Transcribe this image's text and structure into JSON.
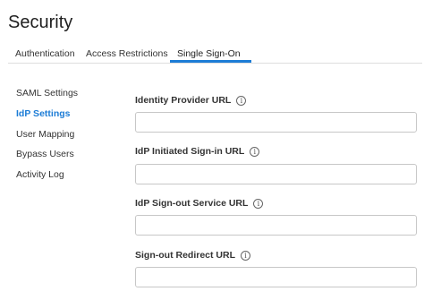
{
  "header": {
    "title": "Security"
  },
  "tabs": [
    {
      "label": "Authentication",
      "active": false
    },
    {
      "label": "Access Restrictions",
      "active": false
    },
    {
      "label": "Single Sign-On",
      "active": true
    }
  ],
  "sidebar": {
    "items": [
      {
        "label": "SAML Settings",
        "active": false
      },
      {
        "label": "IdP Settings",
        "active": true
      },
      {
        "label": "User Mapping",
        "active": false
      },
      {
        "label": "Bypass Users",
        "active": false
      },
      {
        "label": "Activity Log",
        "active": false
      }
    ]
  },
  "form": {
    "fields": [
      {
        "label": "Identity Provider URL",
        "value": "",
        "icon": "info-icon"
      },
      {
        "label": "IdP Initiated Sign-in URL",
        "value": "",
        "icon": "info-icon"
      },
      {
        "label": "IdP Sign-out Service URL",
        "value": "",
        "icon": "info-icon"
      },
      {
        "label": "Sign-out Redirect URL",
        "value": "",
        "icon": "info-icon"
      }
    ]
  },
  "colors": {
    "accent": "#1c7cd6",
    "border": "#c7c7c7",
    "text": "#333333"
  }
}
